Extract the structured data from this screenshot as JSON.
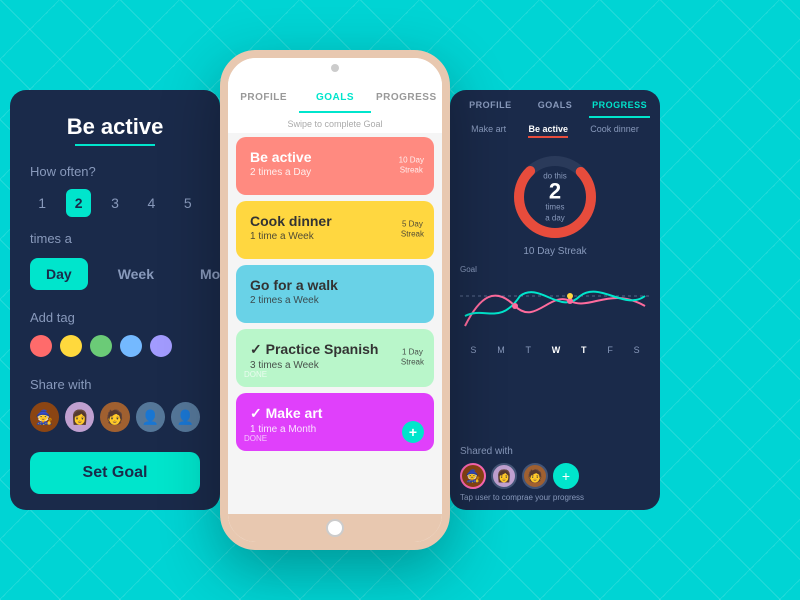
{
  "left_panel": {
    "title": "Be active",
    "how_often_label": "How often?",
    "frequency_numbers": [
      1,
      2,
      3,
      4,
      5
    ],
    "active_frequency": 2,
    "times_label": "times a",
    "periods": [
      "Day",
      "Week",
      "Month"
    ],
    "active_period": "Day",
    "add_tag_label": "Add tag",
    "tag_colors": [
      "#ff6b6b",
      "#ffd93d",
      "#6bcb77",
      "#74b9ff",
      "#a29bfe"
    ],
    "share_label": "Share with",
    "set_goal_label": "Set Goal"
  },
  "center_phone": {
    "tabs": [
      "PROFILE",
      "GOALS",
      "PROGRESS"
    ],
    "active_tab": "GOALS",
    "swipe_hint": "Swipe to complete Goal",
    "goals": [
      {
        "title": "Be active",
        "sub": "2 times a Day",
        "streak": "10 Day\nStreak",
        "color": "#ff8a80",
        "done": false
      },
      {
        "title": "Cook dinner",
        "sub": "1 time a Week",
        "streak": "5 Day\nStreak",
        "color": "#ffd740",
        "done": false
      },
      {
        "title": "Go for a walk",
        "sub": "2 times a Week",
        "streak": "",
        "color": "#69d2e7",
        "done": false
      },
      {
        "title": "Practice Spanish",
        "sub": "3 times a Week",
        "streak": "1 Day\nStreak",
        "color": "#b9f6ca",
        "done": true
      },
      {
        "title": "Make art",
        "sub": "1 time a Month",
        "streak": "",
        "color": "#e040fb",
        "done": true
      }
    ]
  },
  "right_panel": {
    "tabs": [
      "PROFILE",
      "GOALS",
      "PROGRESS"
    ],
    "active_tab": "PROGRESS",
    "goal_nav": [
      "Make art",
      "Be active",
      "Cook dinner"
    ],
    "active_goal": "Be active",
    "do_this_label": "do this",
    "number": "2",
    "times_label": "times",
    "a_day_label": "a day",
    "streak_label": "10 Day Streak",
    "goal_line_label": "Goal",
    "week_days": [
      "S",
      "M",
      "T",
      "W",
      "T",
      "F",
      "S"
    ],
    "highlight_day": "T",
    "shared_title": "Shared with",
    "tap_hint": "Tap user to comprae your progress",
    "add_label": "+"
  }
}
